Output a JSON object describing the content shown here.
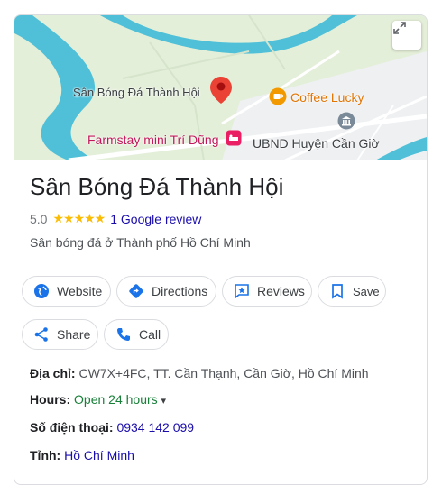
{
  "map": {
    "place_label": "Sân Bóng Đá Thành Hội",
    "poi_coffee": "Coffee Lucky",
    "poi_farmstay": "Farmstay mini Trí Dũng",
    "poi_ubnd": "UBND Huyện Cần Giờ",
    "expand_icon": "expand-icon",
    "colors": {
      "water": "#4fc0d8",
      "land": "#e4efd9",
      "road": "#ffffff",
      "pin": "#ea4335",
      "coffee": "#e37400",
      "farm": "#e91e63"
    }
  },
  "place": {
    "title": "Sân Bóng Đá Thành Hội",
    "rating": "5.0",
    "stars": "★★★★★",
    "review_link": "1 Google review",
    "category": "Sân bóng đá ở Thành phố Hồ Chí Minh"
  },
  "actions": {
    "website": "Website",
    "directions": "Directions",
    "reviews": "Reviews",
    "save": "Save",
    "share": "Share",
    "call": "Call"
  },
  "info": {
    "address_label": "Địa chỉ:",
    "address_value": "CW7X+4FC, TT. Cần Thạnh, Cần Giờ, Hồ Chí Minh",
    "hours_label": "Hours:",
    "hours_value": "Open 24 hours",
    "hours_caret": "▾",
    "phone_label": "Số điện thoại:",
    "phone_value": "0934 142 099",
    "province_label": "Tỉnh:",
    "province_value": "Hồ Chí Minh"
  }
}
